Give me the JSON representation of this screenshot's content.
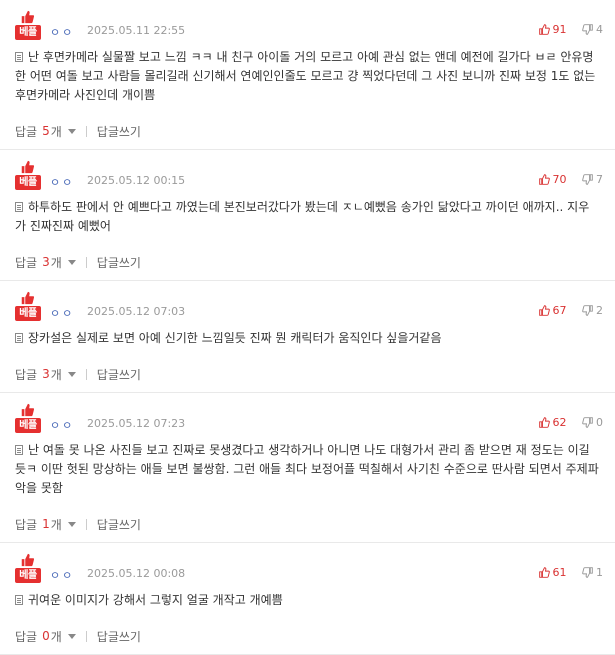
{
  "comments": [
    {
      "badge": "베플",
      "nick": "ㅇㅇ",
      "date": "2025.05.11 22:55",
      "up": "91",
      "down": "4",
      "text": "난 후면카메라 실물짤 보고 느낌 ㅋㅋ 내 친구 아이돌 거의 모르고 아예 관심 없는 앤데 예전에 길가다 ㅂㄹ 안유명한 어떤 여돌 보고 사람들 몰리길래 신기해서 연예인인줄도 모르고 걍 찍었다던데 그 사진 보니까 진짜 보정 1도 없는 후면카메라 사진인데 개이쁨",
      "reply_label": "답글",
      "reply_count": "5",
      "reply_unit": "개",
      "write_label": "답글쓰기"
    },
    {
      "badge": "베플",
      "nick": "ㅇㅇ",
      "date": "2025.05.12 00:15",
      "up": "70",
      "down": "7",
      "text": "하투하도 판에서 안 예쁘다고 까였는데 본진보러갔다가 봤는데 ㅈㄴ예뻤음 송가인 닮았다고 까이던 애까지.. 지우가 진짜진짜 예뻤어",
      "reply_label": "답글",
      "reply_count": "3",
      "reply_unit": "개",
      "write_label": "답글쓰기"
    },
    {
      "badge": "베플",
      "nick": "ㅇㅇ",
      "date": "2025.05.12 07:03",
      "up": "67",
      "down": "2",
      "text": "장카설은 실제로 보면 아예 신기한 느낌일듯 진짜 뭔 캐릭터가 움직인다 싶을거같음",
      "reply_label": "답글",
      "reply_count": "3",
      "reply_unit": "개",
      "write_label": "답글쓰기"
    },
    {
      "badge": "베플",
      "nick": "ㅇㅇ",
      "date": "2025.05.12 07:23",
      "up": "62",
      "down": "0",
      "text": "난 여돌 못 나온 사진들 보고 진짜로 못생겼다고 생각하거나 아니면 나도 대형가서 관리 좀 받으면 재 정도는 이길듯ㅋ 이딴 헛된 망상하는 애들 보면 불쌍함. 그런 애들 최다 보정어플 떡칠해서 사기친 수준으로 딴사람 되면서 주제파악을 못함",
      "reply_label": "답글",
      "reply_count": "1",
      "reply_unit": "개",
      "write_label": "답글쓰기"
    },
    {
      "badge": "베플",
      "nick": "ㅇㅇ",
      "date": "2025.05.12 00:08",
      "up": "61",
      "down": "1",
      "text": "귀여운 이미지가 강해서 그렇지 얼굴 개작고 개예쁨",
      "reply_label": "답글",
      "reply_count": "0",
      "reply_unit": "개",
      "write_label": "답글쓰기"
    }
  ],
  "colors": {
    "accent_red": "#d93232",
    "badge_red": "#e53030",
    "nick_blue": "#4a6ab8",
    "meta_gray": "#9a9a9a"
  },
  "icons": {
    "badge_icon": "thumbs-up-icon",
    "up_icon": "thumbs-up-icon",
    "down_icon": "thumbs-down-icon",
    "text_icon": "document-icon",
    "toggle_icon": "chevron-down-icon"
  }
}
